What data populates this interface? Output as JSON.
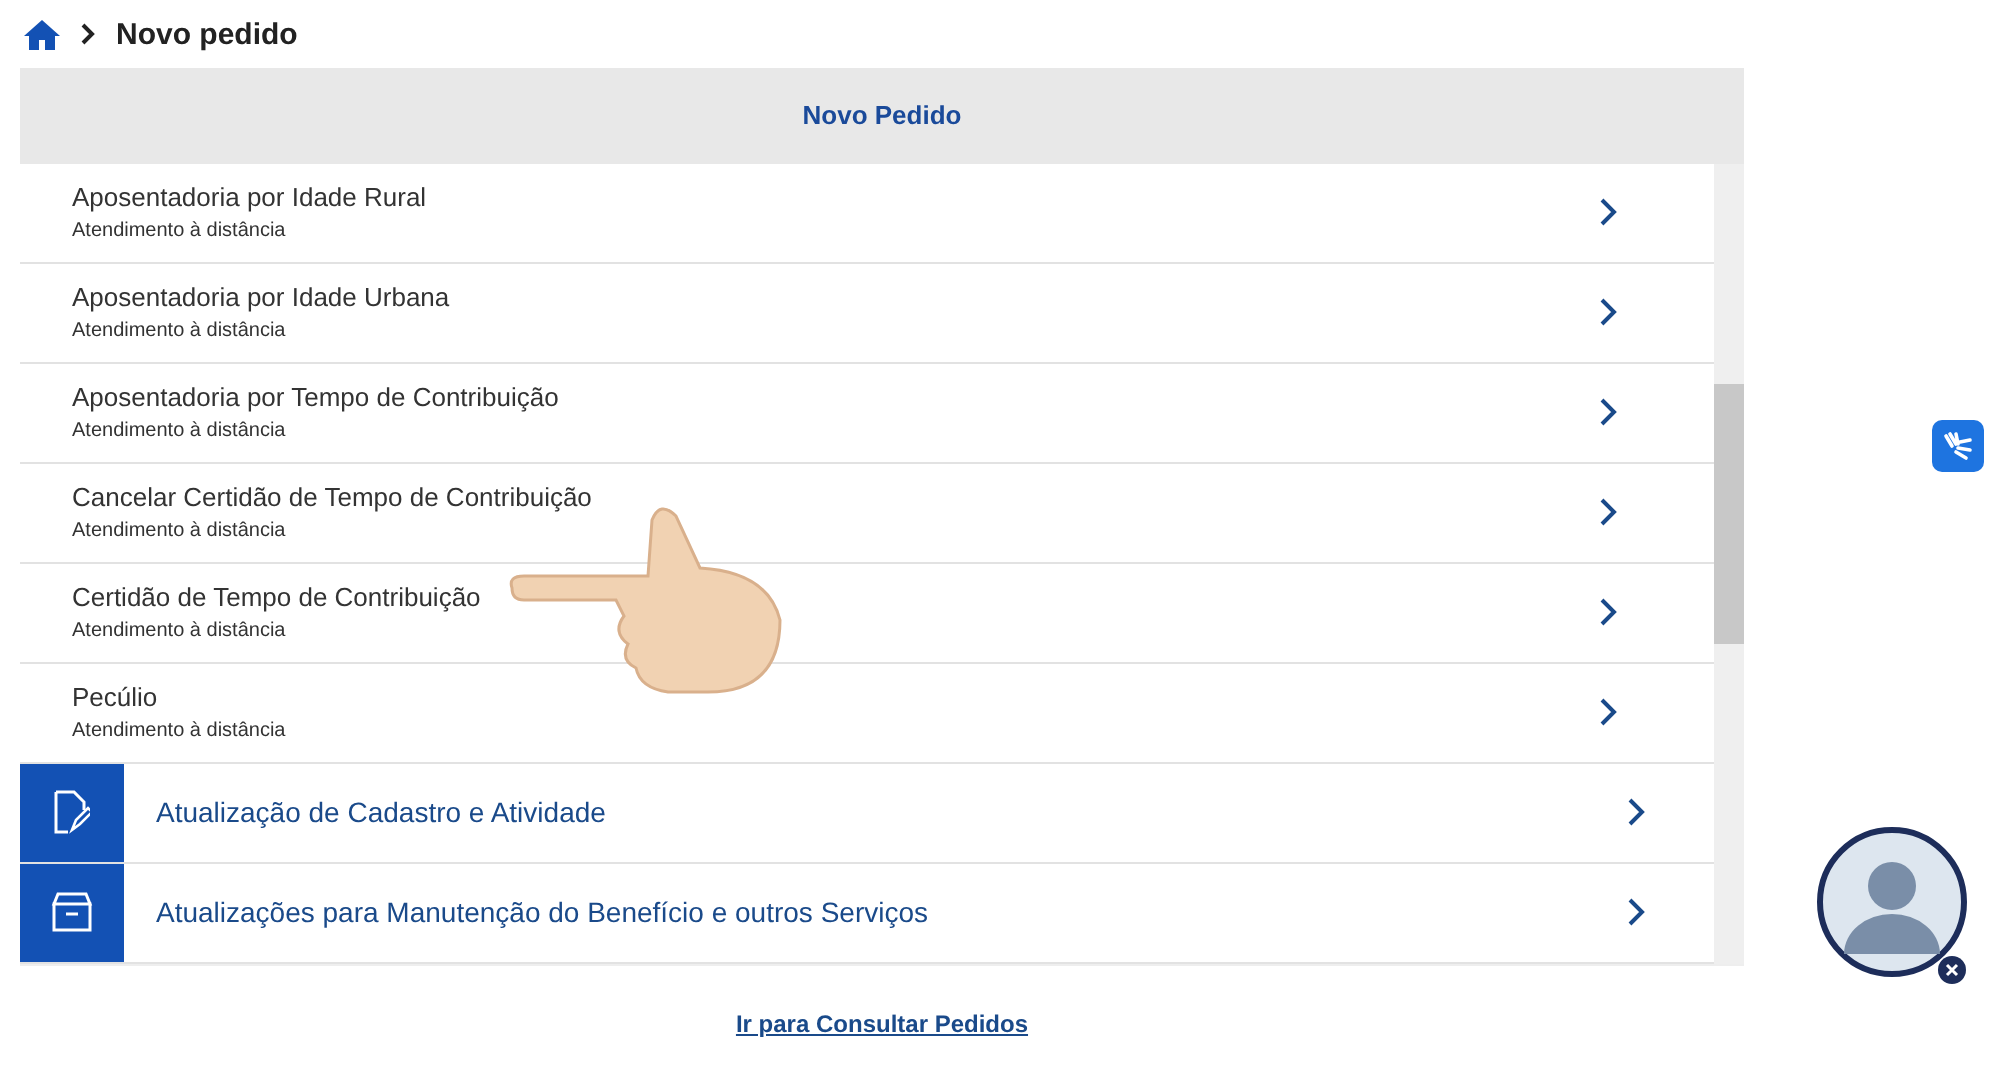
{
  "breadcrumb": {
    "current": "Novo pedido"
  },
  "panel": {
    "title": "Novo Pedido",
    "services": [
      {
        "name": "Aposentadoria por Idade Rural",
        "mode": "Atendimento à distância"
      },
      {
        "name": "Aposentadoria por Idade Urbana",
        "mode": "Atendimento à distância"
      },
      {
        "name": "Aposentadoria por Tempo de Contribuição",
        "mode": "Atendimento à distância"
      },
      {
        "name": "Cancelar Certidão de Tempo de Contribuição",
        "mode": "Atendimento à distância"
      },
      {
        "name": "Certidão de Tempo de Contribuição",
        "mode": "Atendimento à distância"
      },
      {
        "name": "Pecúlio",
        "mode": "Atendimento à distância"
      }
    ],
    "categories": [
      {
        "kind": "edit",
        "label": "Atualização de Cadastro e Atividade"
      },
      {
        "kind": "archive",
        "label": "Atualizações para Manutenção do Benefício e outros Serviços"
      }
    ],
    "footer_link": "Ir para Consultar Pedidos"
  }
}
